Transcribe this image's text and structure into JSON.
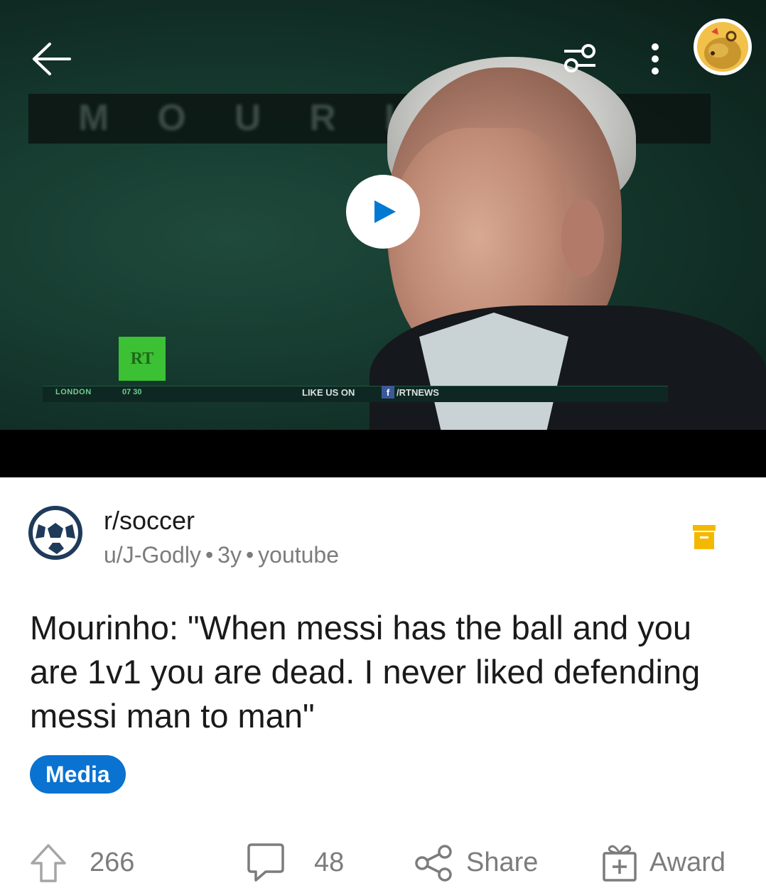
{
  "video": {
    "banner_text": "MOURINHO",
    "channel_logo": "RT",
    "ticker_city": "LONDON",
    "ticker_time": "07 30",
    "ticker_like": "LIKE US ON",
    "ticker_handle": "/RTNEWS"
  },
  "header": {
    "back_icon": "arrow-left",
    "filter_icon": "sliders",
    "more_icon": "vertical-ellipsis"
  },
  "post": {
    "subreddit": "r/soccer",
    "author": "u/J-Godly",
    "age": "3y",
    "source": "youtube",
    "separator": "•",
    "title": "Mourinho: \"When messi has the ball and you are 1v1 you are dead. I never liked defending messi man to man\"",
    "flair": "Media"
  },
  "actions": {
    "upvotes": "266",
    "comments": "48",
    "share_label": "Share",
    "award_label": "Award"
  },
  "colors": {
    "flair_bg": "#0a72d1",
    "archive_icon": "#f5b800",
    "muted_text": "#7c7c7c",
    "title_text": "#1a1a1b"
  }
}
